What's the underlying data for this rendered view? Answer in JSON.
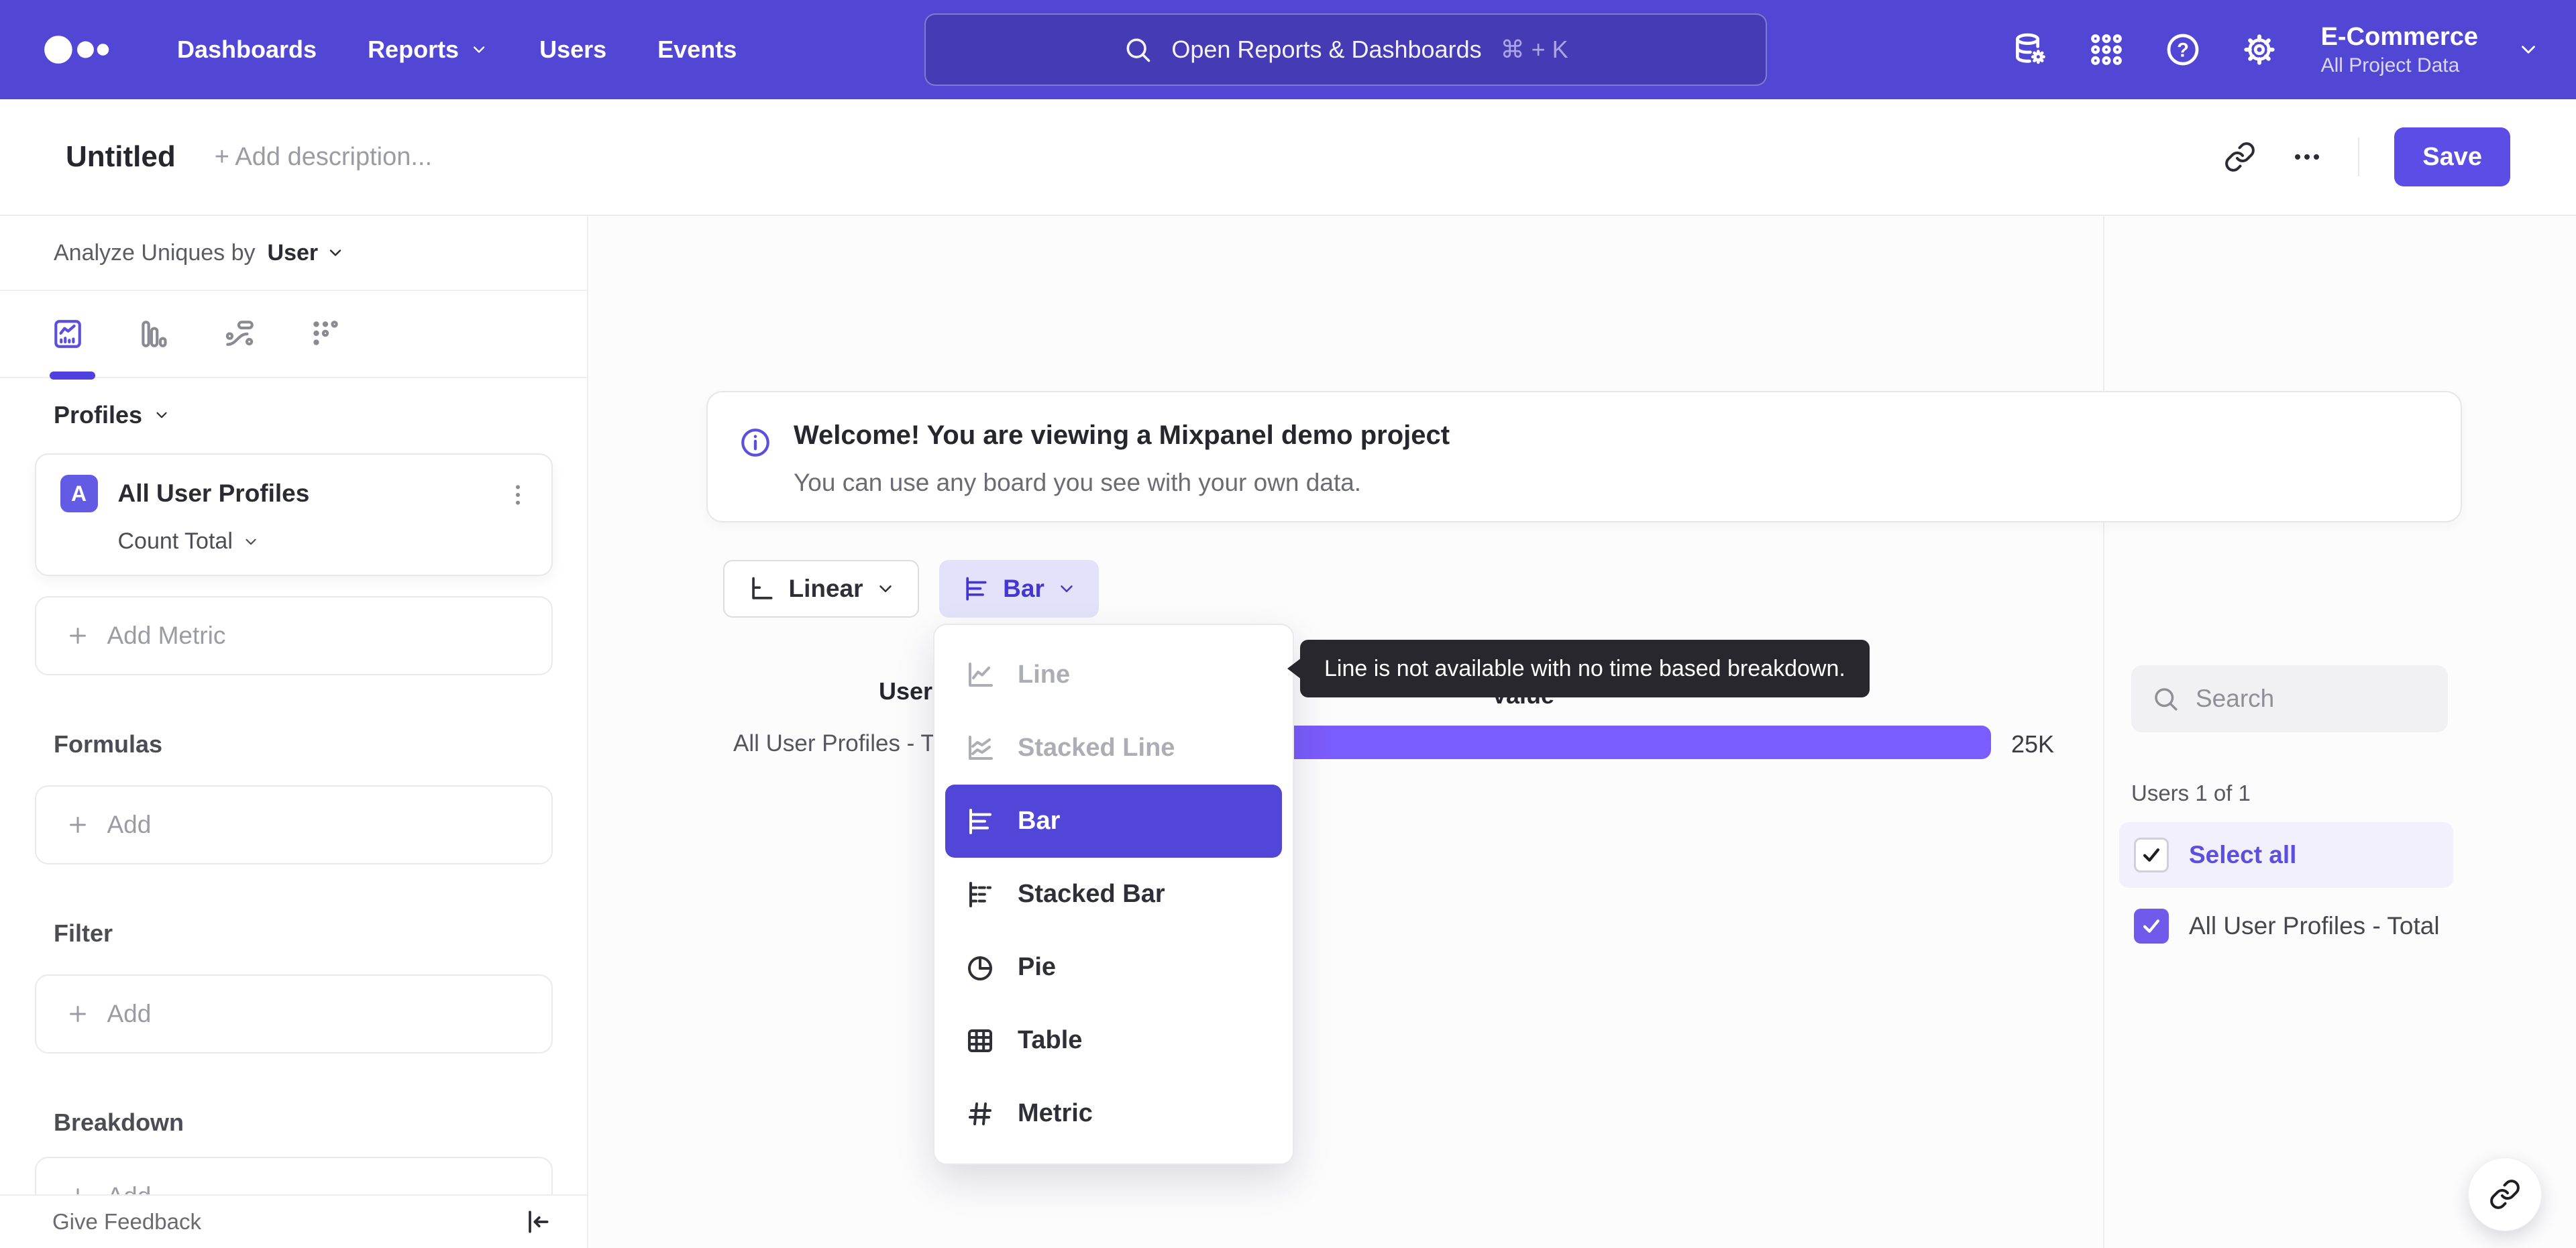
{
  "colors": {
    "accent": "#5247d5",
    "save_button": "#5b4de6",
    "bar": "#7b5cfc",
    "menu_selected": "#5246d9",
    "tooltip_bg": "#27272d"
  },
  "topnav": {
    "items": [
      {
        "label": "Dashboards"
      },
      {
        "label": "Reports"
      },
      {
        "label": "Users"
      },
      {
        "label": "Events"
      }
    ],
    "search": {
      "placeholder": "Open Reports & Dashboards",
      "shortcut": "⌘ + K"
    },
    "project": {
      "name": "E-Commerce",
      "scope": "All Project Data"
    }
  },
  "header": {
    "title": "Untitled",
    "description_placeholder": "+ Add description...",
    "save_label": "Save"
  },
  "sidebar": {
    "analyze_prefix": "Analyze Uniques by",
    "analyze_value": "User",
    "profiles_header": "Profiles",
    "metric": {
      "letter": "A",
      "name": "All User Profiles",
      "aggregation": "Count Total"
    },
    "add_metric_label": "Add Metric",
    "sections": [
      {
        "title": "Formulas",
        "add_label": "Add"
      },
      {
        "title": "Filter",
        "add_label": "Add"
      },
      {
        "title": "Breakdown",
        "add_label": "Add"
      }
    ],
    "feedback_label": "Give Feedback"
  },
  "banner": {
    "title": "Welcome! You are viewing a Mixpanel demo project",
    "subtitle": "You can use any board you see with your own data."
  },
  "controls": {
    "scale_label": "Linear",
    "chart_type_label": "Bar"
  },
  "chart_menu": {
    "items": [
      {
        "label": "Line",
        "state": "disabled"
      },
      {
        "label": "Stacked Line",
        "state": "disabled"
      },
      {
        "label": "Bar",
        "state": "selected"
      },
      {
        "label": "Stacked Bar",
        "state": "normal"
      },
      {
        "label": "Pie",
        "state": "normal"
      },
      {
        "label": "Table",
        "state": "normal"
      },
      {
        "label": "Metric",
        "state": "normal"
      }
    ]
  },
  "tooltip": {
    "text": "Line is not available with no time based breakdown."
  },
  "chart_data": {
    "type": "bar",
    "orientation": "horizontal",
    "columns": [
      "Users",
      "Value"
    ],
    "categories": [
      "All User Profiles - Total"
    ],
    "values": [
      25000
    ],
    "value_labels": [
      "25K"
    ],
    "bar_color": "#7b5cfc"
  },
  "legend": {
    "search_placeholder": "Search",
    "count_label": "Users 1 of 1",
    "select_all_label": "Select all",
    "items": [
      {
        "label": "All User Profiles - Total",
        "checked": true
      }
    ]
  },
  "icons": {
    "help_glyph": "?"
  }
}
